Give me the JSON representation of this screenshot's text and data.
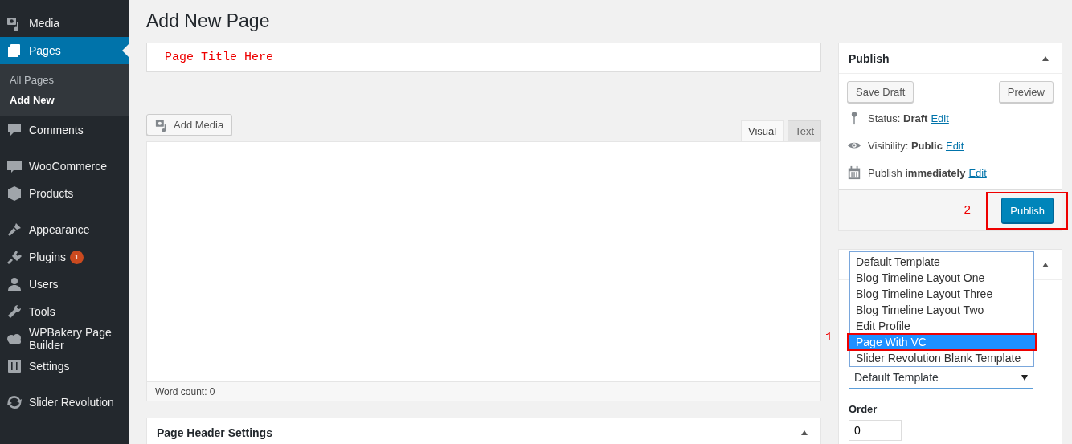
{
  "sidebar": {
    "items": [
      {
        "label": "Media",
        "selected": false
      },
      {
        "label": "Pages",
        "selected": true,
        "children": [
          {
            "label": "All Pages",
            "selected": false
          },
          {
            "label": "Add New",
            "selected": true
          }
        ]
      },
      {
        "label": "Comments",
        "selected": false
      },
      {
        "label": "WooCommerce",
        "selected": false
      },
      {
        "label": "Products",
        "selected": false
      },
      {
        "label": "Appearance",
        "selected": false
      },
      {
        "label": "Plugins",
        "selected": false,
        "badge": "1"
      },
      {
        "label": "Users",
        "selected": false
      },
      {
        "label": "Tools",
        "selected": false
      },
      {
        "label": "WPBakery Page Builder",
        "selected": false
      },
      {
        "label": "Settings",
        "selected": false
      },
      {
        "label": "Slider Revolution",
        "selected": false
      }
    ]
  },
  "heading": "Add New Page",
  "title_field": {
    "value": "Page Title Here"
  },
  "add_media_button": "Add Media",
  "editor_tabs": [
    {
      "label": "Visual",
      "selected": true
    },
    {
      "label": "Text",
      "selected": false
    }
  ],
  "word_count": "Word count: 0",
  "page_header_box": {
    "title": "Page Header Settings"
  },
  "publish_box": {
    "title": "Publish",
    "save_draft": "Save Draft",
    "preview": "Preview",
    "meta": [
      {
        "text": "Status: **Draft**",
        "link": "Edit"
      },
      {
        "text": "Visibility: **Public**",
        "link": "Edit"
      },
      {
        "text": "Publish **immediately**",
        "link": "Edit"
      }
    ],
    "annotation": "2",
    "publish_button": "Publish"
  },
  "attributes_box": {
    "template_options": [
      {
        "label": "Default Template",
        "selected": false
      },
      {
        "label": "Blog Timeline Layout One",
        "selected": false
      },
      {
        "label": "Blog Timeline Layout Three",
        "selected": false
      },
      {
        "label": "Blog Timeline Layout Two",
        "selected": false
      },
      {
        "label": "Edit Profile",
        "selected": false
      },
      {
        "label": "Page With VC",
        "selected": true
      },
      {
        "label": "Slider Revolution Blank Template",
        "selected": false
      }
    ],
    "annotation": "1",
    "template_value": "Default Template",
    "order_label": "Order",
    "order_value": "0"
  }
}
